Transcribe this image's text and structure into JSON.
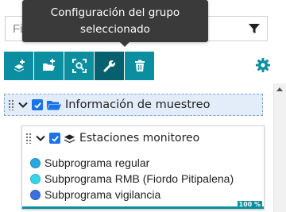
{
  "filter": {
    "placeholder": "Filtrar capas"
  },
  "tooltip": {
    "line1": "Configuración del grupo",
    "line2": "seleccionado"
  },
  "toolbar": {
    "color": "#0b8ea0",
    "active_color": "#07606d",
    "buttons": [
      {
        "icon": "add-layer-icon"
      },
      {
        "icon": "add-folder-icon"
      },
      {
        "icon": "zoom-to-extent-icon"
      },
      {
        "icon": "wrench-icon",
        "active": true
      },
      {
        "icon": "trash-icon"
      }
    ]
  },
  "group": {
    "label": "Información de muestreo",
    "checked": true,
    "expanded": true
  },
  "subgroup": {
    "label": "Estaciones monitoreo",
    "checked": true,
    "expanded": true,
    "items": [
      {
        "label": "Subprograma regular",
        "color": "#29a7e1"
      },
      {
        "label": "Subprograma RMB (Fiordo Pitipalena)",
        "color": "#35d4ea"
      },
      {
        "label": "Subprograma vigilancia",
        "color": "#3a6fe0"
      }
    ],
    "progress_percent": 100,
    "progress_label": "100 %"
  }
}
